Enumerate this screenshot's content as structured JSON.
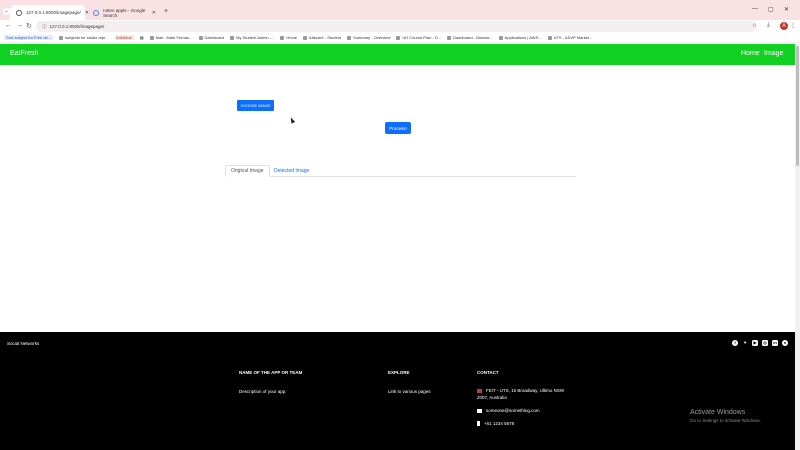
{
  "browser": {
    "tabs": [
      {
        "title": "127.0.0.1:8000/imagepage/",
        "active": true
      },
      {
        "title": "rotten apple - Google Search",
        "active": false
      }
    ],
    "url": "127.0.0.1:8000/imagepage/",
    "profile_initial": "A",
    "bookmarks": [
      {
        "label": "Sort subject for Free de...",
        "style": "hl1"
      },
      {
        "label": "subjects for studio repl...",
        "style": "plain"
      },
      {
        "label": "interface",
        "style": "hl2"
      },
      {
        "label": "",
        "style": "grid"
      },
      {
        "label": "Mail - Mark Fernan...",
        "style": "plain"
      },
      {
        "label": "Dashboard",
        "style": "plain"
      },
      {
        "label": "My Student Admin -...",
        "style": "plain"
      },
      {
        "label": "Home",
        "style": "plain"
      },
      {
        "label": "Altecare - Student",
        "style": "plain"
      },
      {
        "label": "Summary - Overview",
        "style": "plain"
      },
      {
        "label": "UH Course Plan - D...",
        "style": "plain"
      },
      {
        "label": "Dashboard - Manual...",
        "style": "plain"
      },
      {
        "label": "Applications | AWS...",
        "style": "plain"
      },
      {
        "label": "UTS - ADVP Market...",
        "style": "plain"
      }
    ]
  },
  "navbar": {
    "brand": "EatFresh",
    "links": [
      "Home",
      "Image"
    ],
    "color": "#10d022"
  },
  "main": {
    "choose_label": "CHOOSE IMAGE",
    "process_label": "Process!",
    "tabs": [
      "Original Image",
      "Detected Image"
    ],
    "accent": "#0d6efd"
  },
  "footer": {
    "social_label": "Social Networks",
    "social_icons": [
      "facebook-icon",
      "twitter-icon",
      "youtube-icon",
      "instagram-icon",
      "linkedin-icon",
      "github-icon"
    ],
    "col1": {
      "title": "NAME OF THE APP OR TEAM",
      "text": "Description of your app."
    },
    "col2": {
      "title": "EXPLORE",
      "text": "Link to various pages"
    },
    "col3": {
      "title": "CONTACT",
      "address": "FEIT - UTS, 15 Broadway, Ultimo NSW 2007, Australia",
      "email": "someone@something.com",
      "phone": "+61 1234 5678"
    }
  },
  "os_watermark": {
    "title": "Activate Windows",
    "subtitle": "Go to Settings to activate Windows."
  }
}
